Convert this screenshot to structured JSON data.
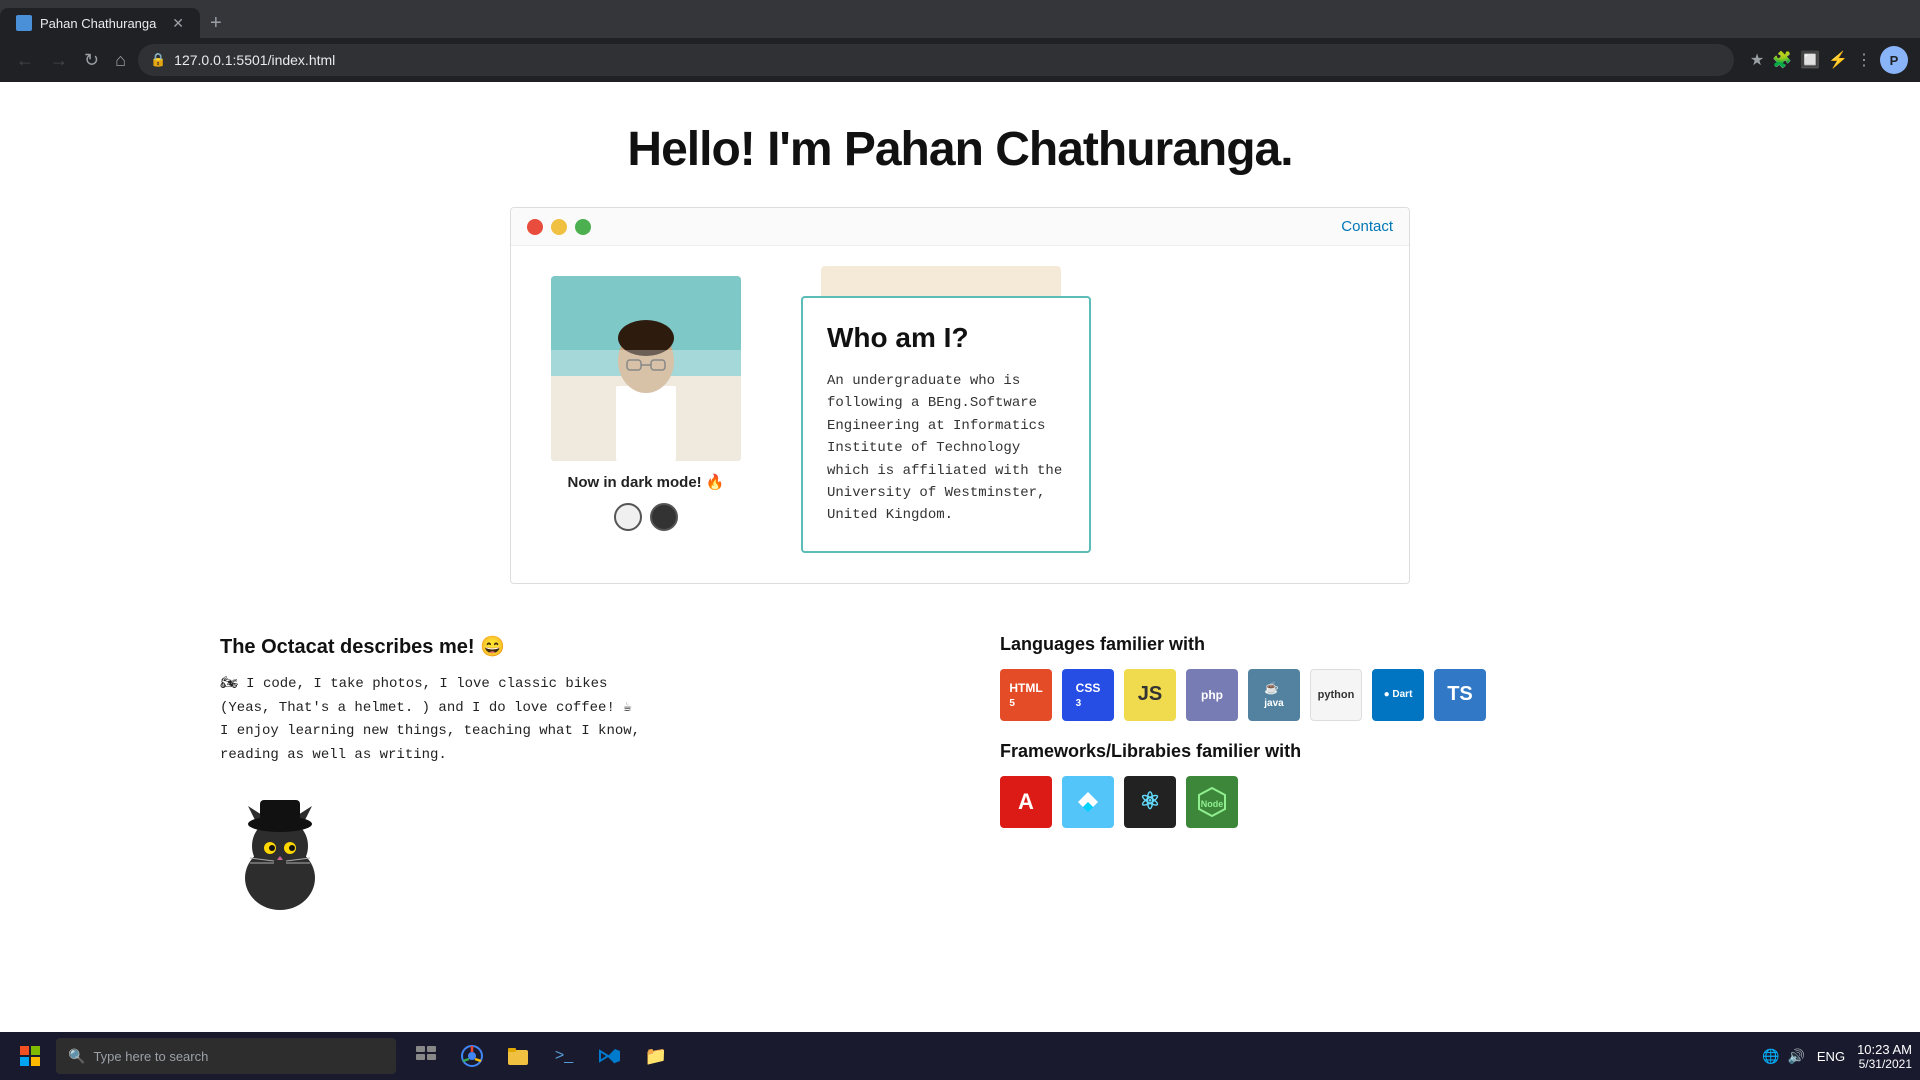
{
  "browser": {
    "tab_title": "Pahan Chathuranga",
    "url": "127.0.0.1:5501/index.html",
    "new_tab_label": "+"
  },
  "page": {
    "title": "Hello! I'm Pahan Chathuranga.",
    "contact_label": "Contact",
    "window_dots": [
      "red",
      "yellow",
      "green"
    ],
    "profile_section": {
      "dark_mode_text": "Now in dark mode! 🔥",
      "toggle_hint": "Toggle dark mode"
    },
    "who_am_i": {
      "title": "Who am I?",
      "description": "An undergraduate who is following a BEng.Software Engineering at Informatics Institute of Technology which is affiliated with the University of Westminster, United Kingdom."
    },
    "octacat_section": {
      "title": "The Octacat describes me! 😄",
      "bio": "🏍 I code, I take photos, I love classic bikes\n(Yeas, That's a helmet. ) and I do love coffee! ☕\nI enjoy learning new things, teaching what I know,\nreading as well as writing."
    },
    "languages_section": {
      "title": "Languages familier with",
      "technologies": [
        {
          "name": "HTML5",
          "label": "HTML",
          "class": "badge-html"
        },
        {
          "name": "CSS3",
          "label": "CSS",
          "class": "badge-css"
        },
        {
          "name": "JavaScript",
          "label": "JS",
          "class": "badge-js"
        },
        {
          "name": "PHP",
          "label": "PHP",
          "class": "badge-php"
        },
        {
          "name": "Java",
          "label": "Java",
          "class": "badge-java"
        },
        {
          "name": "Python",
          "label": "python",
          "class": "badge-python"
        },
        {
          "name": "Dart",
          "label": "● Dart",
          "class": "badge-dart"
        },
        {
          "name": "TypeScript",
          "label": "TS",
          "class": "badge-ts"
        }
      ]
    },
    "frameworks_section": {
      "title": "Frameworks/Librabies familier with",
      "frameworks": [
        {
          "name": "Angular",
          "label": "A",
          "class": "fw-angular"
        },
        {
          "name": "Flutter",
          "label": "🐦",
          "class": "fw-flutter"
        },
        {
          "name": "React",
          "label": "⚛",
          "class": "fw-react"
        },
        {
          "name": "Node.js",
          "label": "⬡",
          "class": "fw-node"
        }
      ]
    }
  },
  "taskbar": {
    "search_placeholder": "Type here to search",
    "time": "10:23 AM",
    "date": "5/31/2021",
    "language": "ENG",
    "apps": [
      "🪟",
      "🔍",
      "⊞",
      "🌐",
      "📁",
      "💻",
      "🔷",
      "📁"
    ]
  }
}
